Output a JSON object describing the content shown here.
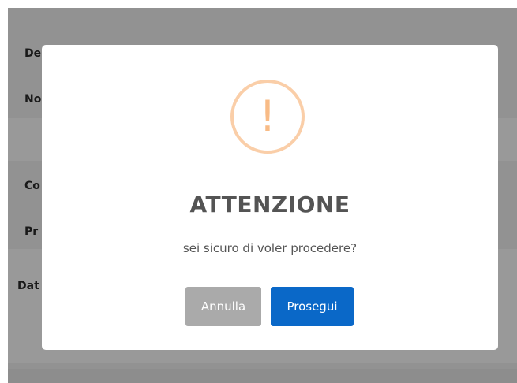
{
  "background_page": {
    "labels": [
      "De",
      "No",
      "Co",
      "Pr",
      "Dat"
    ]
  },
  "dialog": {
    "icon": "exclamation-icon",
    "icon_glyph": "!",
    "title": "ATTENZIONE",
    "message": "sei sicuro di voler procedere?",
    "cancel_label": "Annulla",
    "confirm_label": "Prosegui"
  },
  "colors": {
    "icon_ring": "#facea8",
    "icon_glyph": "#f8bb86",
    "cancel_button": "#aaaaaa",
    "confirm_button": "#0a68c8",
    "title_text": "#545454"
  }
}
